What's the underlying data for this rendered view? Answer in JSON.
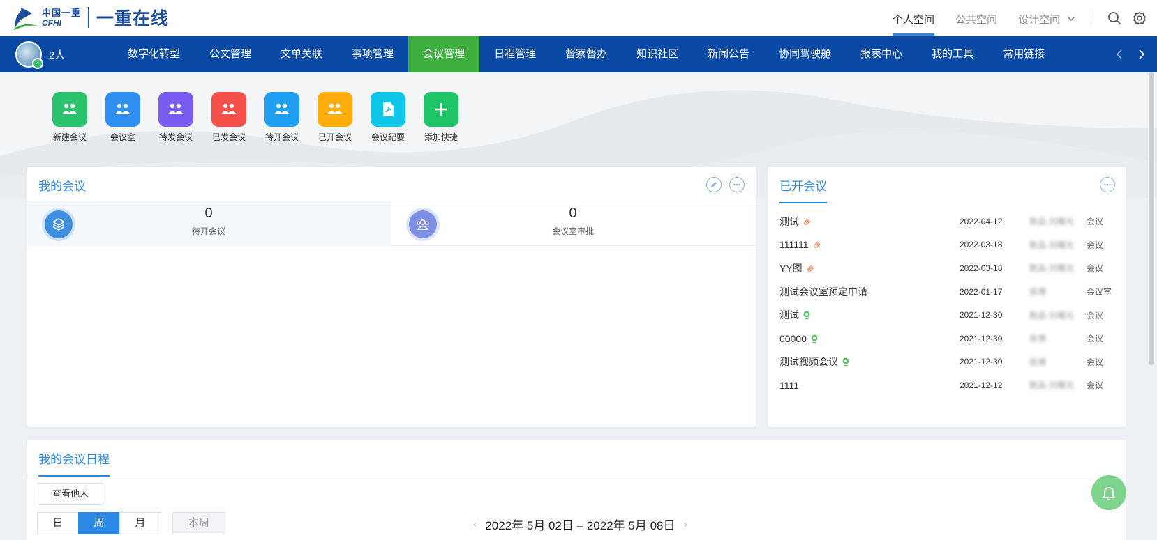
{
  "header": {
    "logo_line1": "中国一重",
    "logo_line2": "CFHI",
    "app_name": "一重在线",
    "spaces": [
      "个人空间",
      "公共空间",
      "设计空间"
    ],
    "active_space": 0
  },
  "nav": {
    "user_count": "2人",
    "items": [
      "数字化转型",
      "公文管理",
      "文单关联",
      "事项管理",
      "会议管理",
      "日程管理",
      "督察督办",
      "知识社区",
      "新闻公告",
      "协同驾驶舱",
      "报表中心",
      "我的工具",
      "常用链接"
    ],
    "active_index": 4
  },
  "quick_actions": [
    {
      "label": "新建会议",
      "color": "#2ac26a",
      "icon": "people-icon"
    },
    {
      "label": "会议室",
      "color": "#2f8ff0",
      "icon": "people-icon"
    },
    {
      "label": "待发会议",
      "color": "#7a5cf2",
      "icon": "people-icon"
    },
    {
      "label": "已发会议",
      "color": "#f5504a",
      "icon": "people-icon"
    },
    {
      "label": "待开会议",
      "color": "#1e9ff2",
      "icon": "people-icon"
    },
    {
      "label": "已开会议",
      "color": "#ffad0d",
      "icon": "people-icon"
    },
    {
      "label": "会议纪要",
      "color": "#10c6e8",
      "icon": "document-pin-icon"
    },
    {
      "label": "添加快捷",
      "color": "#1fc466",
      "icon": "plus-icon"
    }
  ],
  "my_meetings": {
    "title": "我的会议",
    "stats": [
      {
        "value": "0",
        "label": "待开会议",
        "icon_color": "#3f8fe0"
      },
      {
        "value": "0",
        "label": "会议室审批",
        "icon_color": "#7e8fe6"
      }
    ]
  },
  "opened_meetings": {
    "title": "已开会议",
    "rows": [
      {
        "title": "测试",
        "badge": "clip",
        "date": "2022-04-12",
        "author": "数品-刘曙光",
        "type": "会议"
      },
      {
        "title": "111111",
        "badge": "clip",
        "date": "2022-03-18",
        "author": "数品-刘曙光",
        "type": "会议"
      },
      {
        "title": "YY图",
        "badge": "clip",
        "date": "2022-03-18",
        "author": "数品-刘曙光",
        "type": "会议"
      },
      {
        "title": "测试会议室预定申请",
        "badge": "",
        "date": "2022-01-17",
        "author": "侯博",
        "type": "会议室"
      },
      {
        "title": "测试",
        "badge": "camera",
        "date": "2021-12-30",
        "author": "数品-刘曙光",
        "type": "会议"
      },
      {
        "title": "00000",
        "badge": "camera",
        "date": "2021-12-30",
        "author": "侯博",
        "type": "会议"
      },
      {
        "title": "测试视频会议",
        "badge": "camera",
        "date": "2021-12-30",
        "author": "侯博",
        "type": "会议"
      },
      {
        "title": "1111",
        "badge": "",
        "date": "2021-12-12",
        "author": "数品-刘曙光",
        "type": "会议"
      }
    ]
  },
  "schedule": {
    "title": "我的会议日程",
    "view_others": "查看他人",
    "views": [
      "日",
      "周",
      "月"
    ],
    "active_view": 1,
    "this_week": "本周",
    "range": "2022年 5月 02日 – 2022年 5月 08日"
  }
}
